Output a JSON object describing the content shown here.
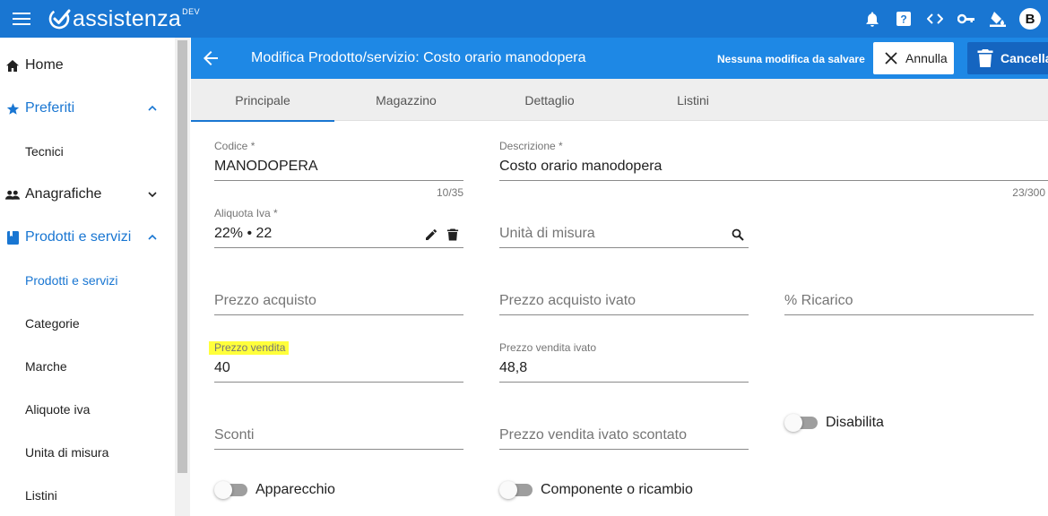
{
  "app": {
    "name": "assistenza",
    "badge": "DEV",
    "user_initial": "B"
  },
  "sidebar": {
    "items": [
      {
        "label": "Home"
      },
      {
        "label": "Preferiti"
      },
      {
        "label": "Tecnici"
      },
      {
        "label": "Anagrafiche"
      },
      {
        "label": "Prodotti e servizi"
      },
      {
        "label": "Prodotti e servizi"
      },
      {
        "label": "Categorie"
      },
      {
        "label": "Marche"
      },
      {
        "label": "Aliquote iva"
      },
      {
        "label": "Unita di misura"
      },
      {
        "label": "Listini"
      }
    ]
  },
  "header": {
    "title": "Modifica Prodotto/servizio: Costo orario manodopera",
    "save_status": "Nessuna modifica da salvare",
    "cancel_label": "Annulla",
    "delete_label": "Cancella"
  },
  "tabs": [
    {
      "label": "Principale"
    },
    {
      "label": "Magazzino"
    },
    {
      "label": "Dettaglio"
    },
    {
      "label": "Listini"
    }
  ],
  "form": {
    "codice": {
      "label": "Codice *",
      "value": "MANODOPERA",
      "counter": "10/35"
    },
    "descrizione": {
      "label": "Descrizione *",
      "value": "Costo orario manodopera",
      "counter": "23/300"
    },
    "aliquota": {
      "label": "Aliquota Iva *",
      "value": "22% • 22"
    },
    "unita": {
      "placeholder": "Unità di misura"
    },
    "prezzo_acquisto": {
      "placeholder": "Prezzo acquisto"
    },
    "prezzo_acquisto_ivato": {
      "placeholder": "Prezzo acquisto ivato"
    },
    "ricarico": {
      "placeholder": "% Ricarico"
    },
    "prezzo_vendita": {
      "label": "Prezzo vendita",
      "value": "40"
    },
    "prezzo_vendita_ivato": {
      "label": "Prezzo vendita ivato",
      "value": "48,8"
    },
    "sconti": {
      "placeholder": "Sconti"
    },
    "prezzo_vendita_ivato_scontato": {
      "placeholder": "Prezzo vendita ivato scontato"
    },
    "disabilita": {
      "label": "Disabilita"
    },
    "apparecchio": {
      "label": "Apparecchio"
    },
    "componente": {
      "label": "Componente o ricambio"
    }
  },
  "colors": {
    "appbar": "#1976d2",
    "pagebar": "#1e88e5",
    "accent": "#1976d2",
    "highlight": "#ffff3b"
  }
}
